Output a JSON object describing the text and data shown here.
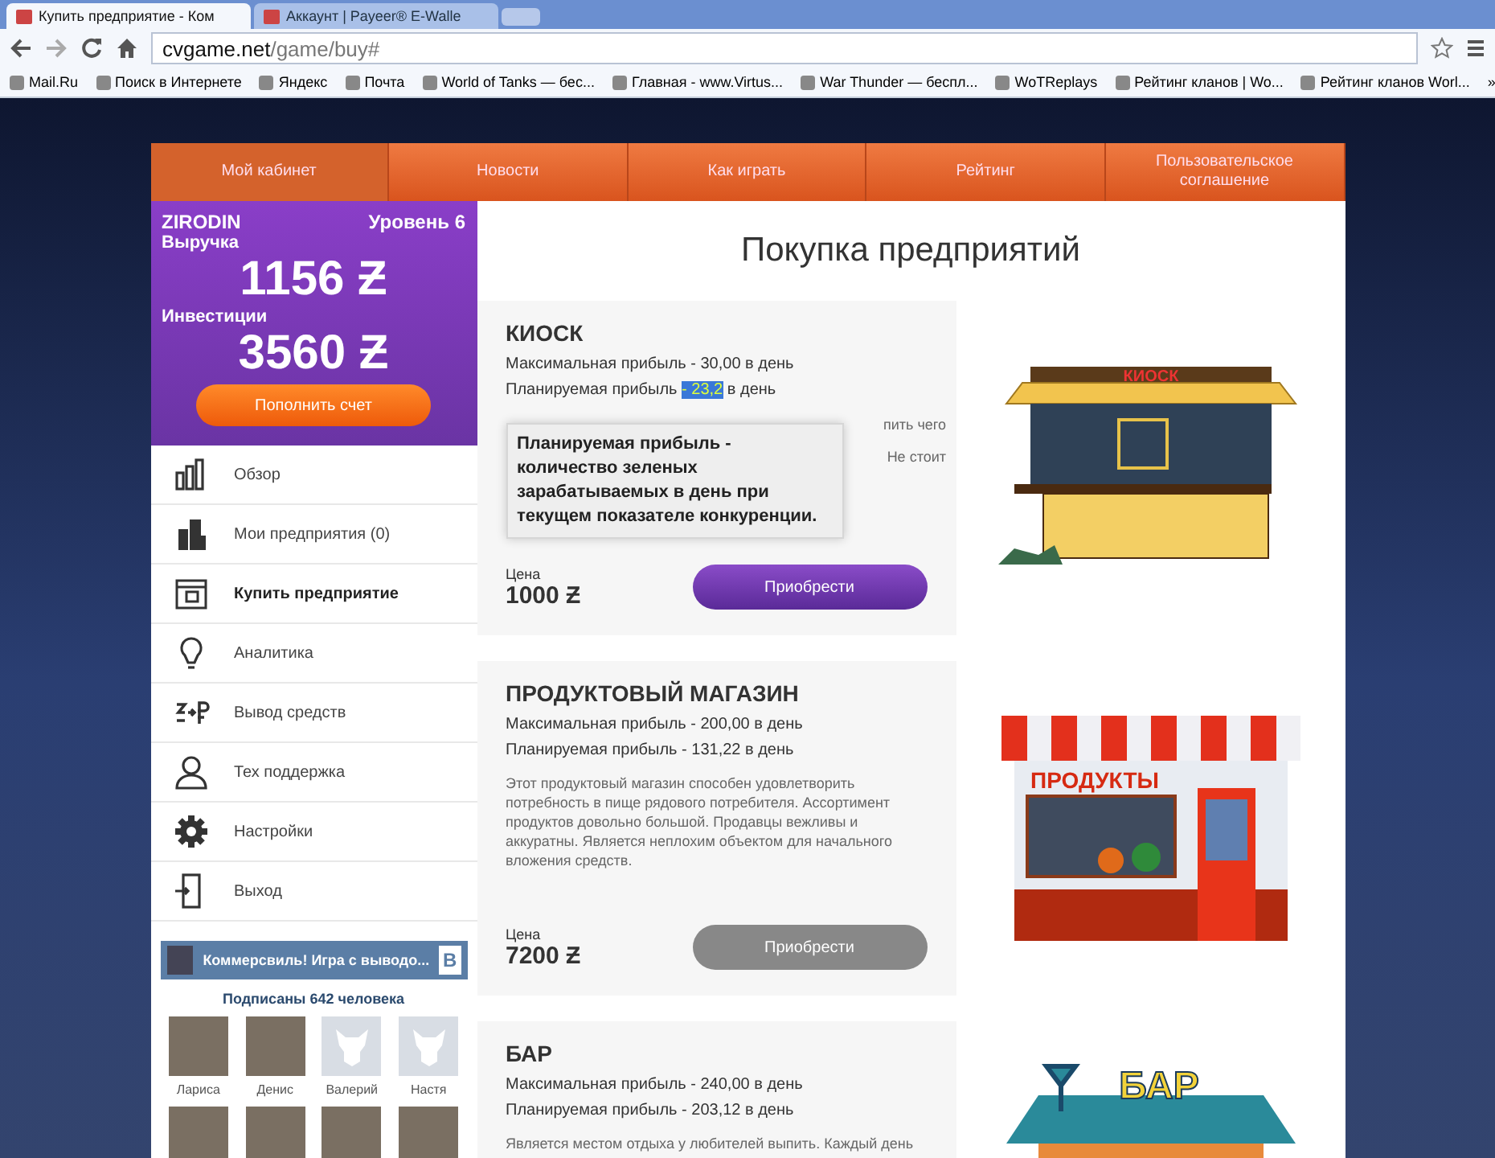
{
  "browser": {
    "tabs": [
      {
        "title": "Купить предприятие - Ком",
        "selected": true
      },
      {
        "title": "Аккаунт | Payeer® E-Walle",
        "selected": false
      }
    ],
    "url": {
      "host": "cvgame.net",
      "path": "/game/buy#"
    },
    "bookmarks": [
      "Mail.Ru",
      "Поиск в Интернете",
      "Яндекс",
      "Почта",
      "World of Tanks — бес...",
      "Главная - www.Virtus...",
      "War Thunder — беспл...",
      "WoTReplays",
      "Рейтинг кланов | Wo...",
      "Рейтинг кланов Worl..."
    ],
    "bookmarks_more": "»"
  },
  "nav": [
    {
      "label": "Мой кабинет",
      "selected": true
    },
    {
      "label": "Новости",
      "selected": false
    },
    {
      "label": "Как играть",
      "selected": false
    },
    {
      "label": "Рейтинг",
      "selected": false
    },
    {
      "label": "Пользовательское соглашение",
      "selected": false
    }
  ],
  "profile": {
    "username": "ZIRODIN",
    "level": "Уровень 6",
    "revenue_label": "Выручка",
    "revenue": "1156 Ƶ",
    "investments_label": "Инвестиции",
    "investments": "3560 Ƶ",
    "topup_button": "Пополнить счет"
  },
  "menu": [
    {
      "label": "Обзор",
      "kind": "chart",
      "selected": false
    },
    {
      "label": "Мои предприятия (0)",
      "kind": "buildings",
      "selected": false
    },
    {
      "label": "Купить предприятие",
      "kind": "store",
      "selected": true
    },
    {
      "label": "Аналитика",
      "kind": "bulb",
      "selected": false
    },
    {
      "label": "Вывод средств",
      "kind": "exchange",
      "selected": false
    },
    {
      "label": "Тех поддержка",
      "kind": "person",
      "selected": false
    },
    {
      "label": "Настройки",
      "kind": "gear",
      "selected": false
    },
    {
      "label": "Выход",
      "kind": "exit",
      "selected": false
    }
  ],
  "vk_widget": {
    "title": "Коммерсвиль! Игра с выводо...",
    "logo": "В",
    "subscribers": "Подписаны 642 человека",
    "members": [
      {
        "name": "Лариса",
        "kind": "photo"
      },
      {
        "name": "Денис",
        "kind": "photo"
      },
      {
        "name": "Валерий",
        "kind": "default"
      },
      {
        "name": "Настя",
        "kind": "default"
      }
    ],
    "more_members": [
      {
        "kind": "photo"
      },
      {
        "kind": "photo"
      },
      {
        "kind": "photo"
      },
      {
        "kind": "photo"
      }
    ]
  },
  "page_title": "Покупка предприятий",
  "products": [
    {
      "kind": "kiosk",
      "name": "КИОСК",
      "sign": "КИОСК",
      "max_profit": "Максимальная прибыль - 30,00 в день",
      "planned_profit": [
        {
          "text": "Планируемая прибыль ",
          "selected": false
        },
        {
          "text": "- 23,2",
          "selected": true
        },
        {
          "text": " в день",
          "selected": false
        }
      ],
      "description_fragments": [
        "пить чего",
        "Не стоит"
      ],
      "tooltip": {
        "title": "Планируемая прибыль -",
        "body": "количество зеленых зарабатываемых в день при текущем показателе конкуренции."
      },
      "price_label": "Цена",
      "price": "1000 Ƶ",
      "button": "Приобрести",
      "disabled": false
    },
    {
      "kind": "shop",
      "name": "ПРОДУКТОВЫЙ МАГАЗИН",
      "sign": "ПРОДУКТЫ",
      "max_profit": "Максимальная прибыль - 200,00 в день",
      "planned_profit": [
        {
          "text": "Планируемая прибыль - 131,22 в день",
          "selected": false
        }
      ],
      "description": [
        "Этот продуктовый магазин способен удовлетворить потребность в пище рядового потребителя. Ассортимент продуктов довольно большой. Продавцы вежливы и аккуратны. Является неплохим объектом для начального вложения средств."
      ],
      "price_label": "Цена",
      "price": "7200 Ƶ",
      "button": "Приобрести",
      "disabled": true
    },
    {
      "kind": "bar",
      "name": "БАР",
      "sign": "БАР",
      "max_profit": "Максимальная прибыль - 240,00 в день",
      "planned_profit": [
        {
          "text": "Планируемая прибыль - 203,12 в день",
          "selected": false
        }
      ],
      "description": [
        "Является местом отдыха у любителей выпить. Каждый день"
      ]
    }
  ]
}
